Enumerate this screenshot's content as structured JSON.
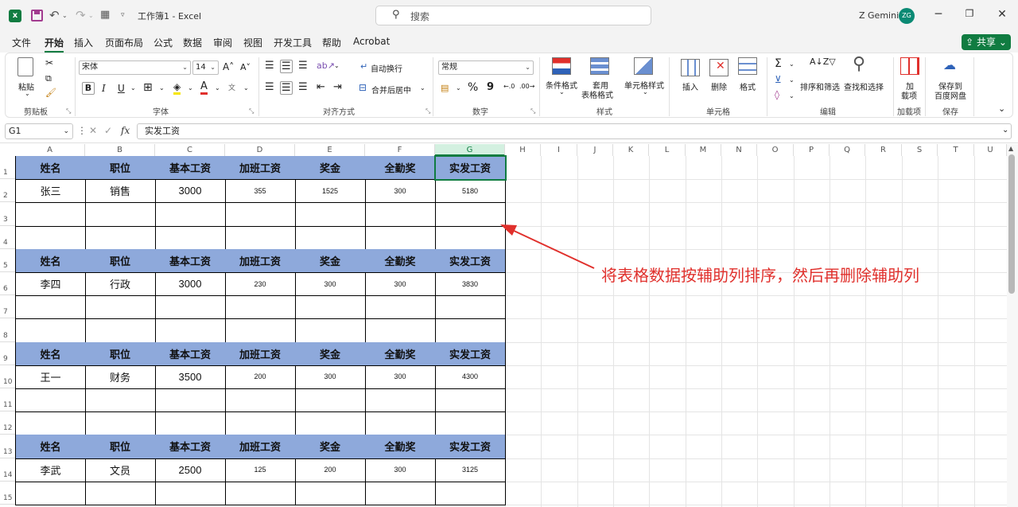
{
  "titlebar": {
    "title": "工作簿1 - Excel",
    "search_placeholder": "搜索",
    "user_name": "Z Gemini",
    "avatar_initials": "ZG",
    "logo_letter": "x"
  },
  "menu": {
    "items": [
      "文件",
      "开始",
      "插入",
      "页面布局",
      "公式",
      "数据",
      "审阅",
      "视图",
      "开发工具",
      "帮助",
      "Acrobat"
    ],
    "active_index": 1,
    "share_label": "共享"
  },
  "ribbon": {
    "clipboard": {
      "paste": "粘贴",
      "label": "剪贴板"
    },
    "font": {
      "name": "宋体",
      "size": "14",
      "bold": "B",
      "italic": "I",
      "underline": "U",
      "label": "字体",
      "grow": "A",
      "shrink": "A"
    },
    "alignment": {
      "wrap": "自动换行",
      "merge": "合并后居中",
      "label": "对齐方式"
    },
    "number": {
      "format": "常规",
      "percent": "%",
      "comma": "9",
      "label": "数字"
    },
    "styles": {
      "conditional": "条件格式",
      "table_a": "套用",
      "table_b": "表格格式",
      "cell_styles": "单元格样式",
      "label": "样式"
    },
    "cells": {
      "insert": "插入",
      "delete": "删除",
      "format": "格式",
      "label": "单元格"
    },
    "editing": {
      "sort_filter": "排序和筛选",
      "find_select": "查找和选择",
      "sigma": "Σ",
      "label": "编辑"
    },
    "addins": {
      "line1": "加",
      "line2": "载项",
      "label": "加载项"
    },
    "save": {
      "line1": "保存到",
      "line2": "百度网盘",
      "label": "保存"
    }
  },
  "formula_bar": {
    "name_box": "G1",
    "content": "实发工资",
    "fx": "fx"
  },
  "sheet": {
    "columns": [
      "A",
      "B",
      "C",
      "D",
      "E",
      "F",
      "G",
      "H",
      "I",
      "J",
      "K",
      "L",
      "M",
      "N",
      "O",
      "P",
      "Q",
      "R",
      "S",
      "T",
      "U"
    ],
    "rows": [
      "1",
      "2",
      "3",
      "4",
      "5",
      "6",
      "7",
      "8",
      "9",
      "10",
      "11",
      "12",
      "13",
      "14",
      "15"
    ],
    "headers": [
      "姓名",
      "职位",
      "基本工资",
      "加班工资",
      "奖金",
      "全勤奖",
      "实发工资"
    ],
    "records": [
      [
        "张三",
        "销售",
        "3000",
        "355",
        "1525",
        "300",
        "5180"
      ],
      [
        "李四",
        "行政",
        "3000",
        "230",
        "300",
        "300",
        "3830"
      ],
      [
        "王一",
        "财务",
        "3500",
        "200",
        "300",
        "300",
        "4300"
      ],
      [
        "李武",
        "文员",
        "2500",
        "125",
        "200",
        "300",
        "3125"
      ]
    ],
    "selected_cell": "G1"
  },
  "annotation": {
    "text": "将表格数据按辅助列排序，然后再删除辅助列",
    "color": "#e0302c"
  },
  "colors": {
    "header_fill": "#8ea9db",
    "accent": "#107c41"
  }
}
